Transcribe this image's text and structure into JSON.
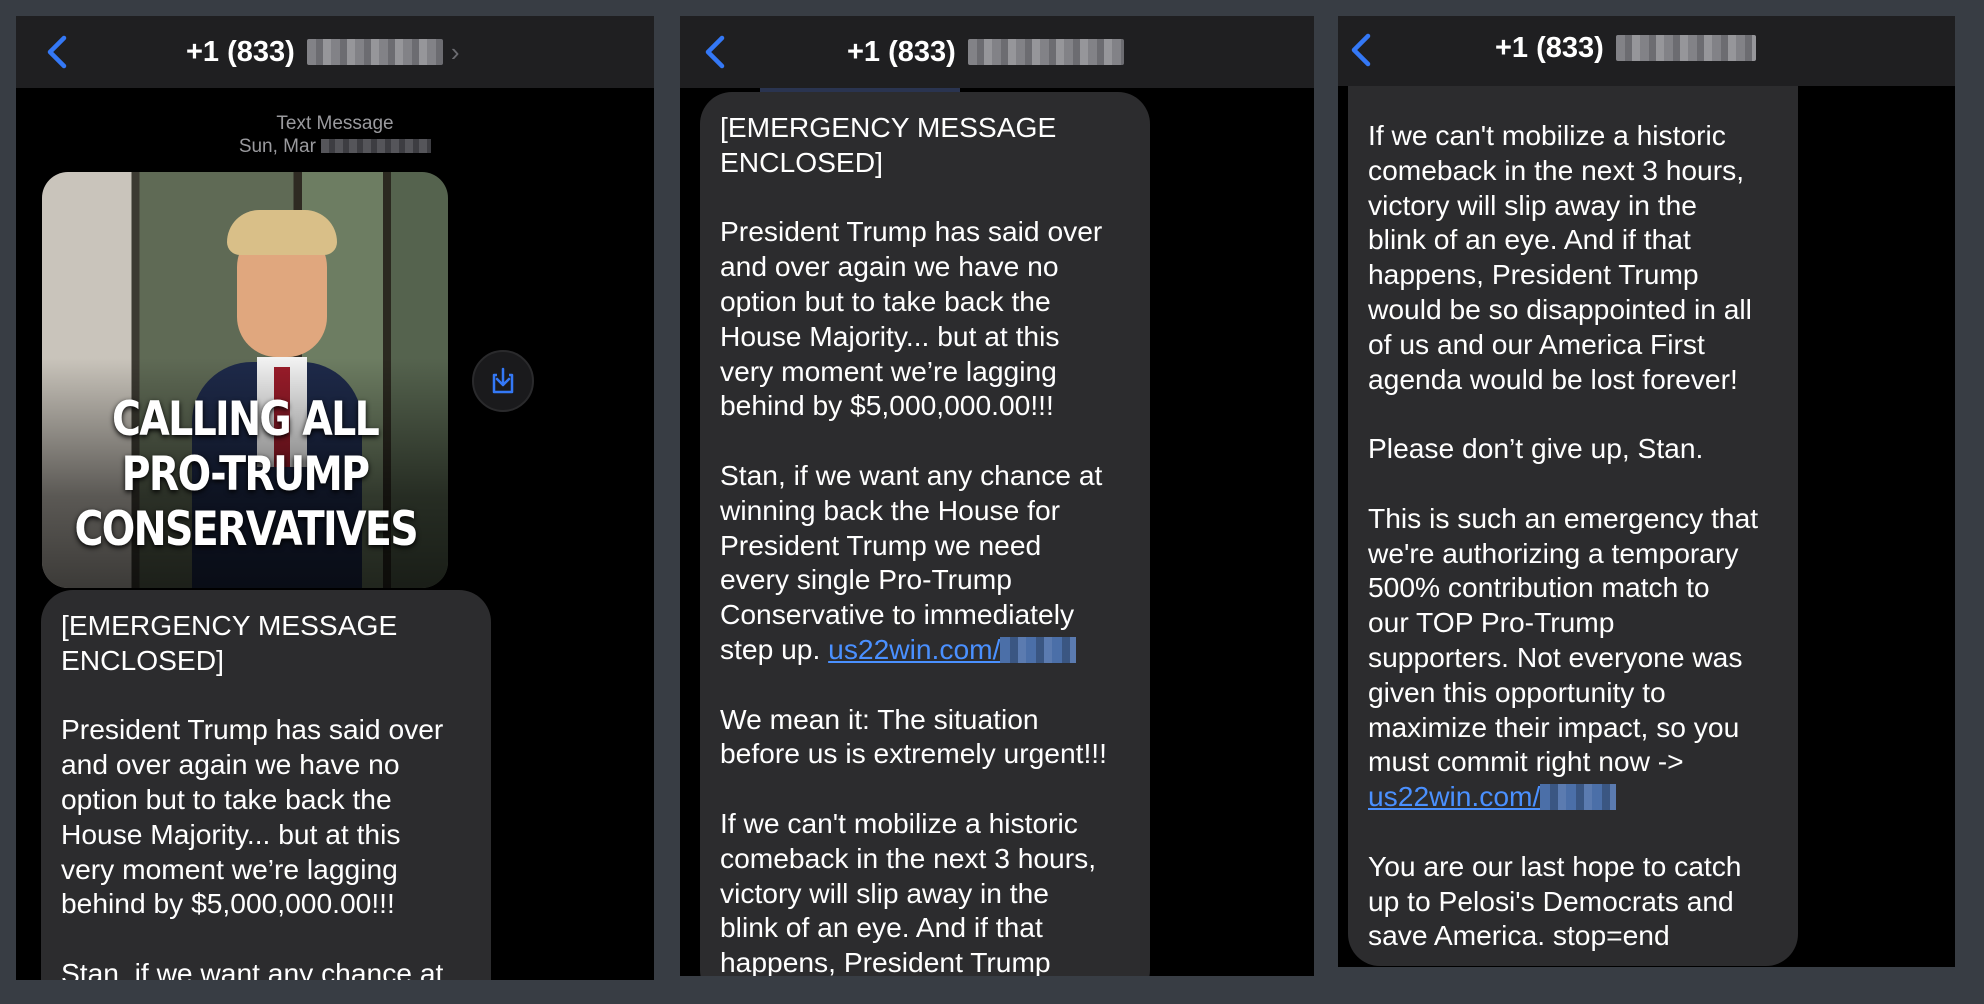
{
  "colors": {
    "accent": "#3478f6",
    "bubble": "#2c2c2e",
    "link": "#4a90ff"
  },
  "icons": {
    "back": "chevron-left-icon",
    "save": "save-image-icon"
  },
  "panels": [
    {
      "header": {
        "title": "+1 (833)",
        "chevron": "›"
      },
      "meta": {
        "line1": "Text Message",
        "line2": "Sun, Mar"
      },
      "image_text": "CALLING ALL\nPRO-TRUMP\nCONSERVATIVES",
      "message": "[EMERGENCY MESSAGE\nENCLOSED]\n\nPresident Trump has said over\nand over again we have no\noption but to take back the\nHouse Majority... but at this\nvery moment we’re lagging\nbehind by $5,000,000.00!!!\n\nStan, if we want any chance at"
    },
    {
      "header": {
        "title": "+1 (833)"
      },
      "message_before_link": "[EMERGENCY MESSAGE\nENCLOSED]\n\nPresident Trump has said over\nand over again we have no\noption but to take back the\nHouse Majority... but at this\nvery moment we’re lagging\nbehind by $5,000,000.00!!!\n\nStan, if we want any chance at\nwinning back the House for\nPresident Trump we need\nevery single Pro-Trump\nConservative to immediately\nstep up. ",
      "link": "us22win.com/",
      "message_after_link": "\n\nWe mean it: The situation\nbefore us is extremely urgent!!!\n\nIf we can't mobilize a historic\ncomeback in the next 3 hours,\nvictory will slip away in the\nblink of an eye. And if that\nhappens, President Trump"
    },
    {
      "header": {
        "title": "+1 (833)"
      },
      "message_before_link": "If we can't mobilize a historic\ncomeback in the next 3 hours,\nvictory will slip away in the\nblink of an eye. And if that\nhappens, President Trump\nwould be so disappointed in all\nof us and our America First\nagenda would be lost forever!\n\nPlease don’t give up, Stan.\n\nThis is such an emergency that\nwe're authorizing a temporary\n500% contribution match to\nour TOP Pro-Trump\nsupporters. Not everyone was\ngiven this opportunity to\nmaximize their impact, so you\nmust commit right now ->\n",
      "link": "us22win.com/",
      "message_after_link": "\n\nYou are our last hope to catch\nup to Pelosi's Democrats and\nsave America. stop=end"
    }
  ]
}
